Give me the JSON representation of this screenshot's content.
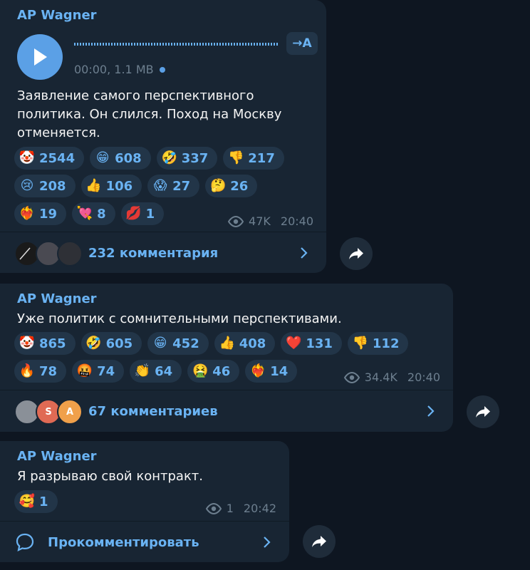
{
  "messages": [
    {
      "author": "AP Wagner",
      "voice": {
        "duration_size": "00:00, 1.1 MB",
        "transcribe_label": "→A"
      },
      "text": "Заявление самого перспективного политика. Он слился. Поход на Москву отменяется.",
      "reactions": [
        {
          "emoji": "🤡",
          "count": "2544"
        },
        {
          "emoji": "😁",
          "count": "608"
        },
        {
          "emoji": "🤣",
          "count": "337"
        },
        {
          "emoji": "👎",
          "count": "217"
        },
        {
          "emoji": "😢",
          "count": "208"
        },
        {
          "emoji": "👍",
          "count": "106"
        },
        {
          "emoji": "😱",
          "count": "27"
        },
        {
          "emoji": "🤔",
          "count": "26"
        },
        {
          "emoji": "❤️‍🔥",
          "count": "19"
        },
        {
          "emoji": "💘",
          "count": "8"
        },
        {
          "emoji": "💋",
          "count": "1"
        }
      ],
      "views": "47K",
      "time": "20:40",
      "comments_label": "232 комментария"
    },
    {
      "author": "AP Wagner",
      "text": "Уже политик с сомнительными перспективами.",
      "reactions": [
        {
          "emoji": "🤡",
          "count": "865"
        },
        {
          "emoji": "🤣",
          "count": "605"
        },
        {
          "emoji": "😁",
          "count": "452"
        },
        {
          "emoji": "👍",
          "count": "408"
        },
        {
          "emoji": "❤️",
          "count": "131"
        },
        {
          "emoji": "👎",
          "count": "112"
        },
        {
          "emoji": "🔥",
          "count": "78"
        },
        {
          "emoji": "🤬",
          "count": "74"
        },
        {
          "emoji": "👏",
          "count": "64"
        },
        {
          "emoji": "🤮",
          "count": "46"
        },
        {
          "emoji": "❤️‍🔥",
          "count": "14"
        }
      ],
      "views": "34.4K",
      "time": "20:40",
      "comments_label": "67 комментариев",
      "avatar_letters": [
        "S",
        "A"
      ]
    },
    {
      "author": "AP Wagner",
      "text": "Я разрываю свой контракт.",
      "reactions": [
        {
          "emoji": "🥰",
          "count": "1"
        }
      ],
      "views": "1",
      "time": "20:42",
      "comments_label": "Прокомментировать"
    }
  ],
  "colors": {
    "background": "#0e1621",
    "bubble": "#182533",
    "accent": "#6ab3f3",
    "muted": "#6d7f8f",
    "reaction_bg": "#223548"
  }
}
